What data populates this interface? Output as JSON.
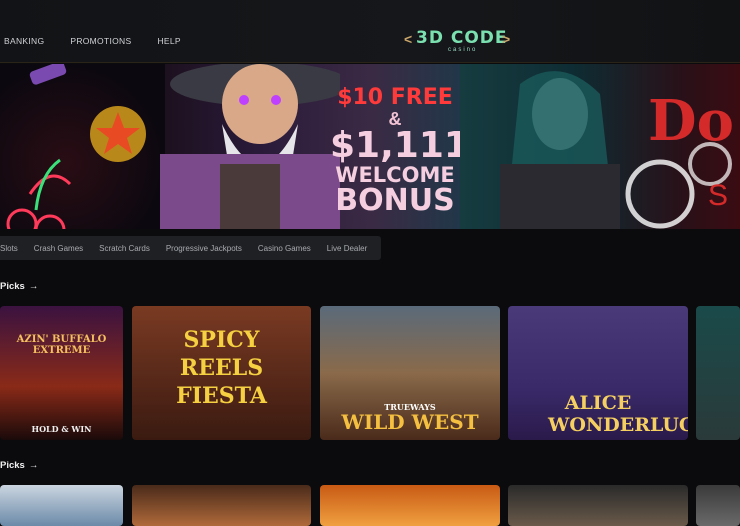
{
  "header": {
    "nav": [
      "BANKING",
      "PROMOTIONS",
      "HELP"
    ],
    "logo_text": "3D CODE",
    "logo_sub": "casino"
  },
  "banner": {
    "line1": "$10 FREE",
    "line2": "&",
    "line3": "$1,111",
    "line4": "WELCOME",
    "line5": "BONUS",
    "side_text": "Do",
    "side_small": "S"
  },
  "categories": [
    "Slots",
    "Crash Games",
    "Scratch Cards",
    "Progressive Jackpots",
    "Casino Games",
    "Live Dealer"
  ],
  "sections": [
    {
      "title": "Picks",
      "arrow": "→"
    },
    {
      "title": "Picks",
      "arrow": "→"
    }
  ],
  "games_row1": [
    {
      "title": "AZIN' BUFFALO EXTREME",
      "sub": "HOLD & WIN",
      "colors": [
        "#2a0d30",
        "#c84a14"
      ]
    },
    {
      "title": "SPICY REELS FIESTA",
      "colors": [
        "#6a2a18",
        "#d4a040"
      ]
    },
    {
      "title": "WILD WEST",
      "sub": "TRUEWAYS",
      "colors": [
        "#3a3a4a",
        "#c87a2a"
      ]
    },
    {
      "title": "ALICE WONDERLUCK",
      "colors": [
        "#3a2a6a",
        "#7a5ab0"
      ]
    },
    {
      "title": "",
      "colors": [
        "#1a3a3a",
        "#2a5a4a"
      ]
    }
  ],
  "games_row2": [
    {
      "colors": [
        "#cbd5e0",
        "#6a8aa8"
      ]
    },
    {
      "colors": [
        "#4a2a1a",
        "#b06a3a"
      ]
    },
    {
      "colors": [
        "#c85a14",
        "#f0a040"
      ]
    },
    {
      "colors": [
        "#2a2a2a",
        "#6a5a4a"
      ]
    },
    {
      "colors": [
        "#3a3a3a",
        "#6a6a6a"
      ]
    }
  ],
  "colors": {
    "accent": "#ff3a3a",
    "logo": "#7be0b0",
    "bg": "#0b0b0d",
    "tab_bg": "#1f2023"
  }
}
